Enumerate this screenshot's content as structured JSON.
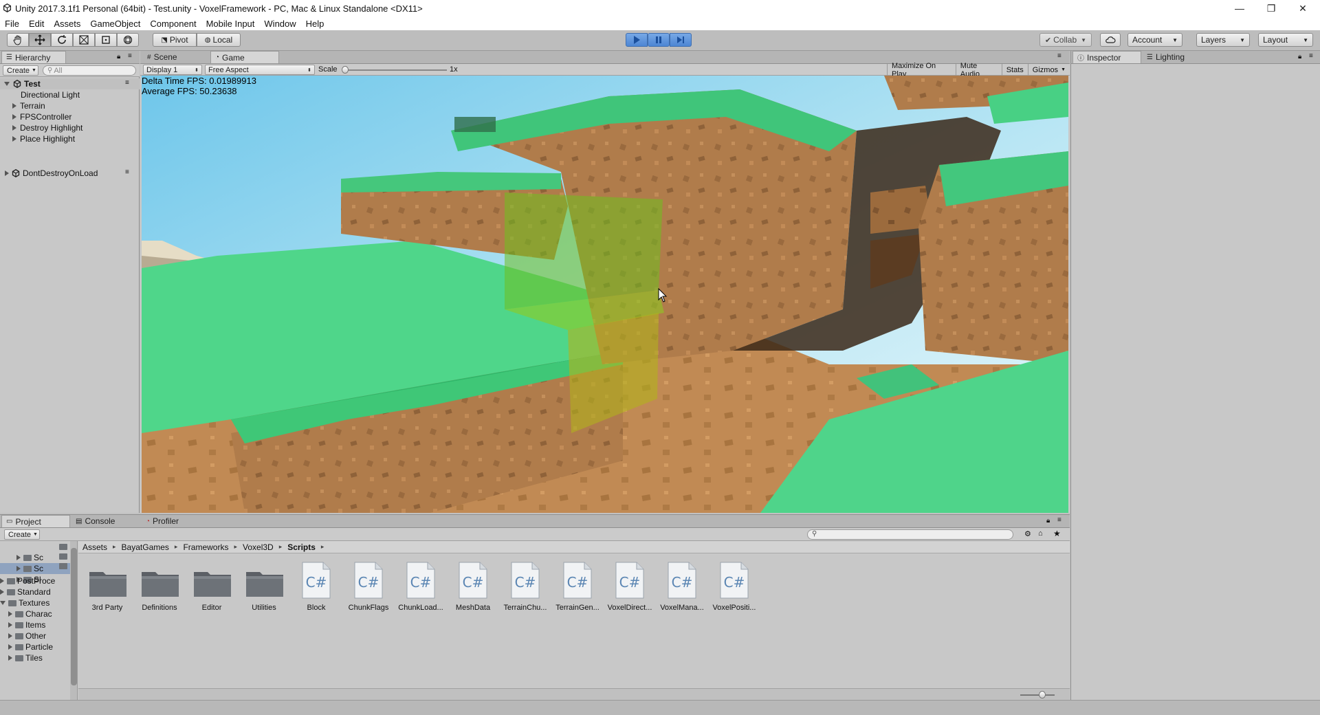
{
  "window": {
    "title": "Unity 2017.3.1f1 Personal (64bit) - Test.unity - VoxelFramework - PC, Mac & Linux Standalone <DX11>",
    "minimize": "—",
    "restore": "❐",
    "close": "✕"
  },
  "menu": [
    "File",
    "Edit",
    "Assets",
    "GameObject",
    "Component",
    "Mobile Input",
    "Window",
    "Help"
  ],
  "toolbar": {
    "pivot_label": "Pivot",
    "local_label": "Local",
    "collab_label": "Collab",
    "account_label": "Account",
    "layers_label": "Layers",
    "layout_label": "Layout"
  },
  "hierarchy": {
    "tab": "Hierarchy",
    "create": "Create",
    "search_placeholder": "All",
    "scene": "Test",
    "items": [
      "Directional Light",
      "Terrain",
      "FPSController",
      "Destroy Highlight",
      "Place Highlight"
    ],
    "dontdestroy": "DontDestroyOnLoad"
  },
  "game": {
    "scene_tab": "Scene",
    "game_tab": "Game",
    "display": "Display 1",
    "aspect": "Free Aspect",
    "scale_label": "Scale",
    "scale_value": "1x",
    "scale_fraction": 0,
    "maximize": "Maximize On Play",
    "mute": "Mute Audio",
    "stats": "Stats",
    "gizmos": "Gizmos",
    "fps_line1": "Delta Time FPS: 0.01989913",
    "fps_line2": "Average FPS: 50.23638"
  },
  "inspector": {
    "tab": "Inspector",
    "lighting_tab": "Lighting"
  },
  "project": {
    "tab": "Project",
    "console_tab": "Console",
    "profiler_tab": "Profiler",
    "create": "Create",
    "breadcrumb": [
      "Assets",
      "BayatGames",
      "Frameworks",
      "Voxel3D",
      "Scripts"
    ],
    "tree": [
      {
        "label": "Sc",
        "indent": 3,
        "open": false,
        "selected": false
      },
      {
        "label": "Sc",
        "indent": 3,
        "open": false,
        "selected": true
      },
      {
        "label": "Sl",
        "indent": 3,
        "open": false,
        "selected": false
      },
      {
        "label": "PostProce",
        "indent": 1,
        "open": false,
        "selected": false
      },
      {
        "label": "Standard",
        "indent": 1,
        "open": false,
        "selected": false
      },
      {
        "label": "Textures",
        "indent": 1,
        "open": true,
        "selected": false
      },
      {
        "label": "Charac",
        "indent": 2,
        "open": false,
        "selected": false
      },
      {
        "label": "Items",
        "indent": 2,
        "open": false,
        "selected": false
      },
      {
        "label": "Other",
        "indent": 2,
        "open": false,
        "selected": false
      },
      {
        "label": "Particle",
        "indent": 2,
        "open": false,
        "selected": false
      },
      {
        "label": "Tiles",
        "indent": 2,
        "open": false,
        "selected": false
      }
    ],
    "folders": [
      "3rd Party",
      "Definitions",
      "Editor",
      "Utilities"
    ],
    "scripts": [
      "Block",
      "ChunkFlags",
      "ChunkLoad...",
      "MeshData",
      "TerrainChu...",
      "TerrainGen...",
      "VoxelDirect...",
      "VoxelMana...",
      "VoxelPositi..."
    ]
  }
}
